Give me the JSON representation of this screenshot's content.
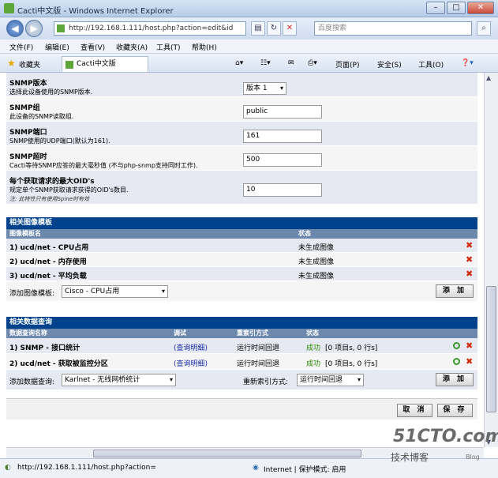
{
  "window": {
    "title": "Cacti中文版 - Windows Internet Explorer"
  },
  "address": {
    "url": "http://192.168.1.111/host.php?action=edit&id",
    "search_placeholder": "百度搜索"
  },
  "menu": [
    "文件(F)",
    "编辑(E)",
    "查看(V)",
    "收藏夹(A)",
    "工具(T)",
    "帮助(H)"
  ],
  "favorites": {
    "label": "收藏夹",
    "tab": "Cacti中文版"
  },
  "commands": {
    "page": "页面(P)",
    "safety": "安全(S)",
    "tools": "工具(O)"
  },
  "snmp": {
    "version": {
      "label": "SNMP版本",
      "desc": "选择此设备使用的SNMP版本.",
      "value": "版本 1"
    },
    "community": {
      "label": "SNMP组",
      "desc": "此设备的SNMP读取组.",
      "value": "public"
    },
    "port": {
      "label": "SNMP端口",
      "desc": "SNMP使用的UDP端口(默认为161).",
      "value": "161"
    },
    "timeout": {
      "label": "SNMP超时",
      "desc": "Cacti等待SNMP应答的最大毫秒值 (不与php-snmp支持同时工作).",
      "value": "500"
    },
    "maxoids": {
      "label": "每个获取请求的最大OID's",
      "desc": "规定单个SNMP获取请求获得的OID's数目.",
      "note": "注: 此特性只有使用Spine时有效",
      "value": "10"
    }
  },
  "graph_templates": {
    "title": "相关图像模板",
    "columns": [
      "图像模板名",
      "状态"
    ],
    "rows": [
      {
        "name": "1) ucd/net - CPU占用",
        "status": "未生成图像"
      },
      {
        "name": "2) ucd/net - 内存使用",
        "status": "未生成图像"
      },
      {
        "name": "3) ucd/net - 平均负载",
        "status": "未生成图像"
      }
    ],
    "add_label": "添加图像模板:",
    "add_value": "Cisco - CPU占用",
    "add_button": "添 加"
  },
  "data_queries": {
    "title": "相关数据查询",
    "columns": [
      "数据查询名称",
      "调试",
      "重索引方式",
      "状态"
    ],
    "rows": [
      {
        "name": "1) SNMP - 接口统计",
        "debug": "(查询明细)",
        "reindex": "运行时间回退",
        "status_ok": "成功",
        "status_info": "[0 项目s, 0 行s]"
      },
      {
        "name": "2) ucd/net - 获取被监控分区",
        "debug": "(查询明细)",
        "reindex": "运行时间回退",
        "status_ok": "成功",
        "status_info": "[0 项目s, 0 行s]"
      }
    ],
    "add_label": "添加数据查询:",
    "add_value": "Karlnet - 无线网桥统计",
    "reindex_label": "重新索引方式:",
    "reindex_value": "运行时间回退",
    "add_button": "添 加"
  },
  "footer": {
    "cancel": "取 消",
    "save": "保 存"
  },
  "status": {
    "url": "http://192.168.1.111/host.php?action=",
    "zone": "Internet | 保护模式: 启用"
  },
  "watermark": {
    "site": "51CTO.com",
    "sub": "技术博客",
    "blog": "Blog"
  },
  "colors": {
    "header_bg": "#00438c",
    "colheader_bg": "#6d88ad",
    "delete": "#d02a0a",
    "ok": "#2a8a00"
  }
}
